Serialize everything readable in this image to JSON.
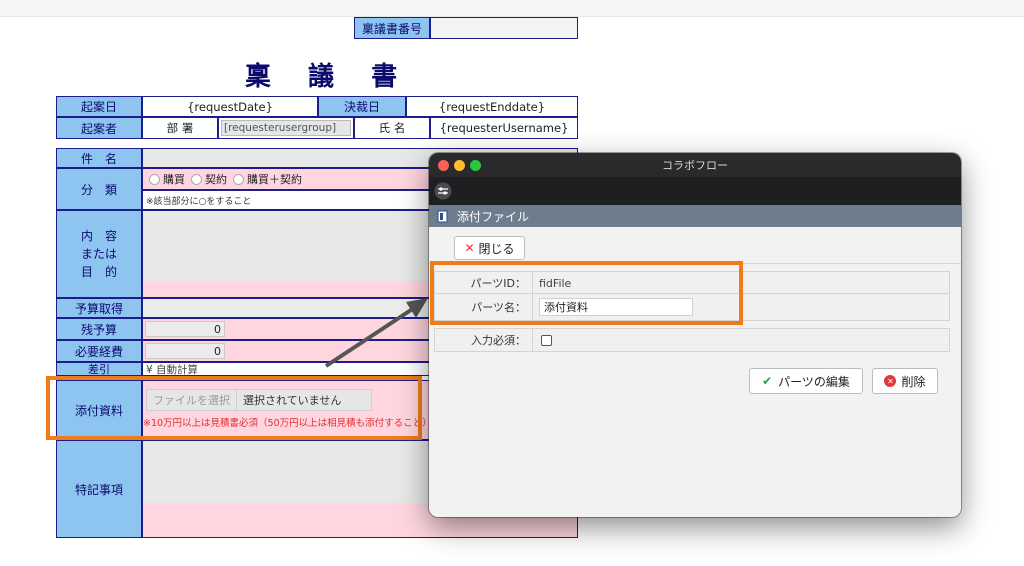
{
  "form": {
    "number_label": "稟議書番号",
    "title": "稟 議 書",
    "request_date_label": "起案日",
    "request_date_value": "{requestDate}",
    "decision_date_label": "決裁日",
    "decision_date_value": "{requestEnddate}",
    "requester_label": "起案者",
    "dept_label": "部 署",
    "dept_value": "[requesterusergroup]",
    "name_label": "氏 名",
    "name_value": "{requesterUsername}",
    "subject_label": "件　名",
    "category_label": "分　類",
    "category_options": [
      "購買",
      "契約",
      "購買＋契約"
    ],
    "category_note": "※該当部分に○をすること",
    "content_label_1": "内　容",
    "content_label_2": "または",
    "content_label_3": "目　的",
    "budget_label": "予算取得",
    "remaining_label": "残予算",
    "remaining_value": "0",
    "required_label": "必要経費",
    "required_value": "0",
    "diff_label": "差引",
    "diff_value": "¥ 自動計算",
    "attach_label": "添付資料",
    "file_button": "ファイルを選択",
    "file_status": "選択されていません",
    "attach_note": "※10万円以上は見積書必須（50万円以上は相見積も添付すること）",
    "notes_label": "特記事項"
  },
  "dialog": {
    "window_title": "コラボフロー",
    "section_title": "添付ファイル",
    "close_button": "閉じる",
    "part_id_label": "パーツID：",
    "part_id_value": "fidFile",
    "part_name_label": "パーツ名：",
    "part_name_value": "添付資料",
    "required_label": "入力必須：",
    "edit_button": "パーツの編集",
    "delete_button": "削除"
  },
  "colors": {
    "header_blue": "#8ec4f0",
    "border_navy": "#1c1c8c",
    "field_pink": "#ffd6df",
    "highlight_orange": "#ef7c1a",
    "dialog_sub_bar": "#6e7d8d"
  },
  "icons": [
    "settings-sliders-icon",
    "attachment-icon",
    "close-x-icon",
    "checkmark-icon",
    "delete-circle-icon",
    "window-close-dot",
    "window-minimize-dot",
    "window-zoom-dot",
    "arrow-icon"
  ]
}
